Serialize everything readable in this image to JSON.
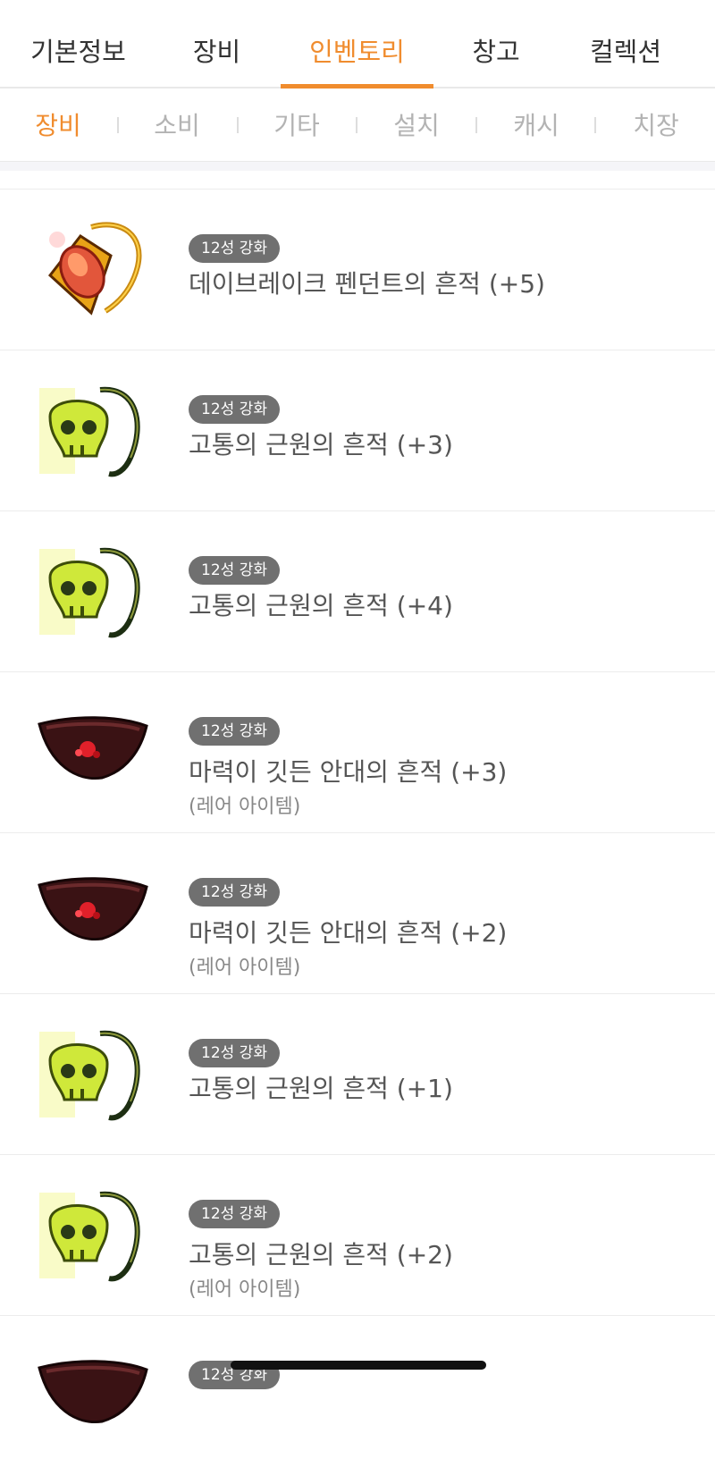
{
  "top_tabs": [
    "기본정보",
    "장비",
    "인벤토리",
    "창고",
    "컬렉션"
  ],
  "sub_tabs": [
    "장비",
    "소비",
    "기타",
    "설치",
    "캐시",
    "치장"
  ],
  "items": [
    {
      "badge": "12성 강화",
      "name": "데이브레이크 펜던트의 흔적 (+5)",
      "sub": "",
      "icon": "pendant-icon"
    },
    {
      "badge": "12성 강화",
      "name": "고통의 근원의 흔적 (+3)",
      "sub": "",
      "icon": "skull-pendant-icon"
    },
    {
      "badge": "12성 강화",
      "name": "고통의 근원의 흔적 (+4)",
      "sub": "",
      "icon": "skull-pendant-icon"
    },
    {
      "badge": "12성 강화",
      "name": "마력이 깃든 안대의 흔적 (+3)",
      "sub": "(레어 아이템)",
      "icon": "eyepatch-icon"
    },
    {
      "badge": "12성 강화",
      "name": "마력이 깃든 안대의 흔적 (+2)",
      "sub": "(레어 아이템)",
      "icon": "eyepatch-icon"
    },
    {
      "badge": "12성 강화",
      "name": "고통의 근원의 흔적 (+1)",
      "sub": "",
      "icon": "skull-pendant-icon"
    },
    {
      "badge": "12성 강화",
      "name": "고통의 근원의 흔적 (+2)",
      "sub": "(레어 아이템)",
      "icon": "skull-pendant-icon"
    },
    {
      "badge": "12성 강화",
      "name": "",
      "sub": "",
      "icon": "eyepatch-icon"
    }
  ]
}
